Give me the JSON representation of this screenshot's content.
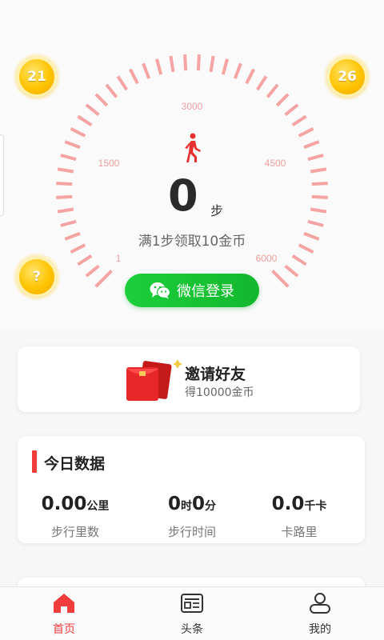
{
  "dial": {
    "tick_labels": [
      "1",
      "1500",
      "3000",
      "4500",
      "6000"
    ],
    "color": "#f5a3a3",
    "step_count": "0",
    "step_unit": "步",
    "reward_text": "满1步领取10金币"
  },
  "coins": {
    "left_top": "21",
    "right_top": "26",
    "left_bottom": "?"
  },
  "login_button": {
    "label": "微信登录"
  },
  "invite_card": {
    "title": "邀请好友",
    "subtitle": "得10000金币"
  },
  "today_stats": {
    "title": "今日数据",
    "distance": {
      "value": "0.00",
      "unit": "公里",
      "label": "步行里数"
    },
    "time": {
      "hours": "0",
      "hours_unit": "时",
      "minutes": "0",
      "minutes_unit": "分",
      "label": "步行时间"
    },
    "calories": {
      "value": "0.0",
      "unit": "千卡",
      "label": "卡路里"
    }
  },
  "tabbar": {
    "items": [
      {
        "label": "首页",
        "icon": "home-icon",
        "active": true
      },
      {
        "label": "头条",
        "icon": "news-icon",
        "active": false
      },
      {
        "label": "我的",
        "icon": "profile-icon",
        "active": false
      }
    ],
    "active_color": "#f23b3b",
    "inactive_color": "#333333"
  },
  "accent_red": "#f23b3b",
  "accent_green": "#1ccf3a"
}
